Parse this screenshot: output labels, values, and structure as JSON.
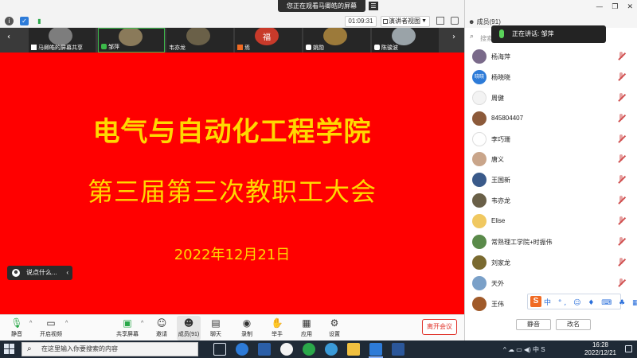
{
  "top_banner": {
    "text": "您正在观看马卿皓的屏幕",
    "menu_icon": "menu-icon"
  },
  "top_bar": {
    "timer": "01:09:31",
    "view_button": "演讲者视图",
    "icons": [
      "info-icon",
      "shield-icon",
      "signal-icon"
    ]
  },
  "video_strip": {
    "tiles": [
      {
        "name": "马卿皓的屏幕共享",
        "thumb_color": "#7d7d7d"
      },
      {
        "name": "邹萍",
        "thumb_color": "#8a7a5a"
      },
      {
        "name": "韦亦龙",
        "thumb_color": "#6a6048"
      },
      {
        "name": "焉",
        "thumb_color": "#c83a2a",
        "badge": "福"
      },
      {
        "name": "姚勋",
        "thumb_color": "#9c7a3a"
      },
      {
        "name": "陈骏波",
        "thumb_color": "#9aa3a8"
      }
    ]
  },
  "slide": {
    "title": "电气与自动化工程学院",
    "subtitle": "第三届第三次教职工大会",
    "date": "2022年12月21日",
    "background": "#ff0000",
    "text_color": "#ffd800"
  },
  "chat_pill": {
    "text": "说点什么..."
  },
  "toolbar": {
    "items": [
      {
        "label": "静音",
        "icon": "microphone-icon"
      },
      {
        "label": "开启视频",
        "icon": "video-icon"
      },
      {
        "label": "共享屏幕",
        "icon": "share-screen-icon"
      },
      {
        "label": "邀请",
        "icon": "invite-icon"
      },
      {
        "label": "成员(91)",
        "icon": "participants-icon"
      },
      {
        "label": "聊天",
        "icon": "chat-icon"
      },
      {
        "label": "录制",
        "icon": "record-icon"
      },
      {
        "label": "举手",
        "icon": "raise-hand-icon"
      },
      {
        "label": "应用",
        "icon": "apps-icon"
      },
      {
        "label": "设置",
        "icon": "settings-icon"
      }
    ],
    "leave_button": "离开会议",
    "leave_color": "#e0332a"
  },
  "panel": {
    "title": "成员(91)",
    "search_placeholder": "搜索",
    "speaking_label": "正在讲话: 邹萍",
    "participants": [
      {
        "name": "杨海萍",
        "avatar_color": "#7a6a8a"
      },
      {
        "name": "杨晓晓",
        "avatar_color": "#2d7bd8",
        "avatar_text": "晓晓"
      },
      {
        "name": "周健",
        "avatar_color": "#f3f3f3"
      },
      {
        "name": "845804407",
        "avatar_color": "#8c5a3a"
      },
      {
        "name": "李巧珊",
        "avatar_color": "#ffffff"
      },
      {
        "name": "唐义",
        "avatar_color": "#c9a58a"
      },
      {
        "name": "王国新",
        "avatar_color": "#3a5a8a"
      },
      {
        "name": "韦亦龙",
        "avatar_color": "#6a6048"
      },
      {
        "name": "Elise",
        "avatar_color": "#f0c860"
      },
      {
        "name": "常熟理工学院+时振伟",
        "avatar_color": "#5a8a4a"
      },
      {
        "name": "刘家龙",
        "avatar_color": "#7a6a30"
      },
      {
        "name": "天外",
        "avatar_color": "#7aa0c8"
      },
      {
        "name": "王伟",
        "avatar_color": "#a05a2a"
      }
    ],
    "ime_label": "S",
    "ime_icons": "中 °, ☺ ♦ ⌨ ♣ ▦",
    "mute_all": "静音",
    "unmute_all": "改名"
  },
  "taskbar": {
    "search_placeholder": "在这里输入你要搜索的内容",
    "tray_text": "^ ☁ ▭ ◀) 中 S",
    "time": "16:28",
    "date": "2022/12/21",
    "apps": [
      "task-view-icon",
      "edge-icon",
      "store-icon",
      "wechat-icon",
      "browser-icon",
      "folder-icon",
      "zoom-icon",
      "word-icon"
    ]
  },
  "colors": {
    "accent": "#2d7bd8",
    "speaking_mic": "#5ad35a"
  }
}
